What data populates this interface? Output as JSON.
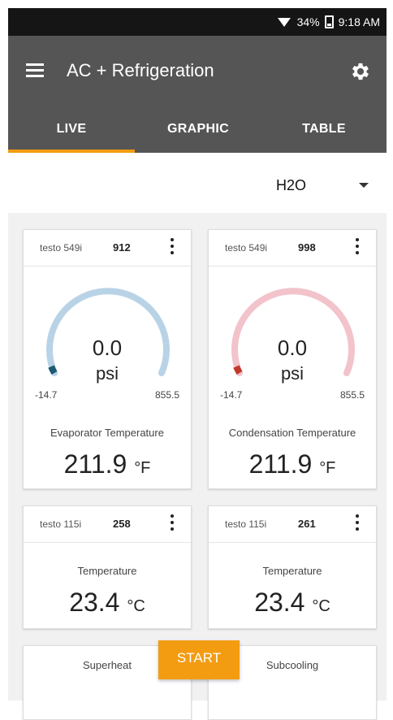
{
  "status_bar": {
    "battery": "34%",
    "time": "9:18 AM"
  },
  "app_bar": {
    "title": "AC + Refrigeration",
    "menu_icon": "hamburger-menu-icon",
    "settings_icon": "gear-icon"
  },
  "tabs": [
    {
      "label": "LIVE",
      "active": true
    },
    {
      "label": "GRAPHIC",
      "active": false
    },
    {
      "label": "TABLE",
      "active": false
    }
  ],
  "unit_selector": {
    "value": "H2O"
  },
  "colors": {
    "accent": "#f39c12",
    "appbar": "#555555",
    "evaporator_gauge": "#b9d3e6",
    "condensation_gauge": "#f2c3cb"
  },
  "cards": [
    {
      "device": "testo 549i",
      "serial": "912",
      "gauge": {
        "value": "0.0",
        "unit": "psi",
        "min": "-14.7",
        "max": "855.5"
      },
      "label": "Evaporator Temperature",
      "value": "211.9",
      "unit": "°F"
    },
    {
      "device": "testo 549i",
      "serial": "998",
      "gauge": {
        "value": "0.0",
        "unit": "psi",
        "min": "-14.7",
        "max": "855.5"
      },
      "label": "Condensation Temperature",
      "value": "211.9",
      "unit": "°F"
    },
    {
      "device": "testo 115i",
      "serial": "258",
      "label": "Temperature",
      "value": "23.4",
      "unit": "°C"
    },
    {
      "device": "testo 115i",
      "serial": "261",
      "label": "Temperature",
      "value": "23.4",
      "unit": "°C"
    },
    {
      "label": "Superheat"
    },
    {
      "label": "Subcooling"
    }
  ],
  "start_button": {
    "label": "START"
  }
}
